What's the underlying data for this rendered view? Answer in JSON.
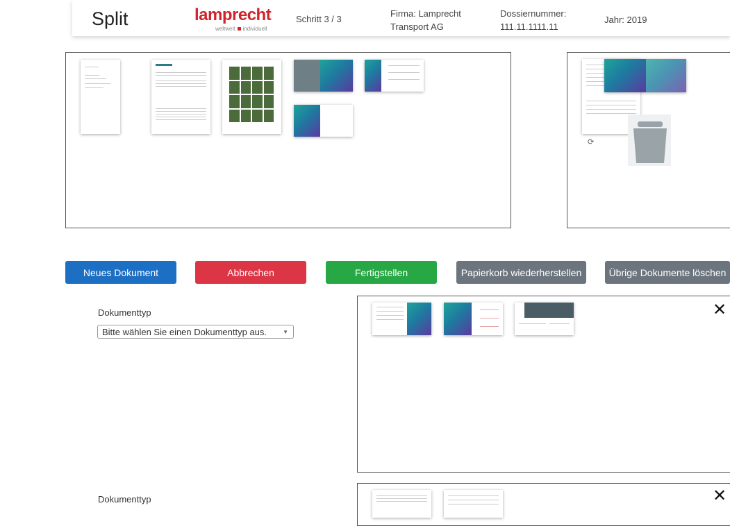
{
  "header": {
    "title": "Split",
    "logo_text": "lamprecht",
    "logo_tagline_left": "weltweit",
    "logo_tagline_right": "individuell",
    "step": "Schritt 3 / 3",
    "company_line1": "Firma: Lamprecht",
    "company_line2": "Transport AG",
    "dossier_line1": "Dossiernummer:",
    "dossier_line2": "111.11.1111.11",
    "year": "Jahr: 2019"
  },
  "buttons": {
    "new_document": "Neues Dokument",
    "cancel": "Abbrechen",
    "finish": "Fertigstellen",
    "restore_trash": "Papierkorb wiederherstellen",
    "delete_remaining": "Übrige Dokumente löschen"
  },
  "documents": [
    {
      "type_label": "Dokumenttyp",
      "type_value": "Bitte wählen Sie einen Dokumenttyp aus."
    },
    {
      "type_label": "Dokumenttyp"
    }
  ],
  "icons": {
    "close": "close-icon",
    "trash": "trash-icon",
    "rotate": "rotate-icon",
    "dropdown": "chevron-down-icon"
  },
  "colors": {
    "primary": "#1d6fc4",
    "danger": "#dc3545",
    "success": "#28a745",
    "secondary": "#6c757d",
    "brand": "#d2232a"
  }
}
